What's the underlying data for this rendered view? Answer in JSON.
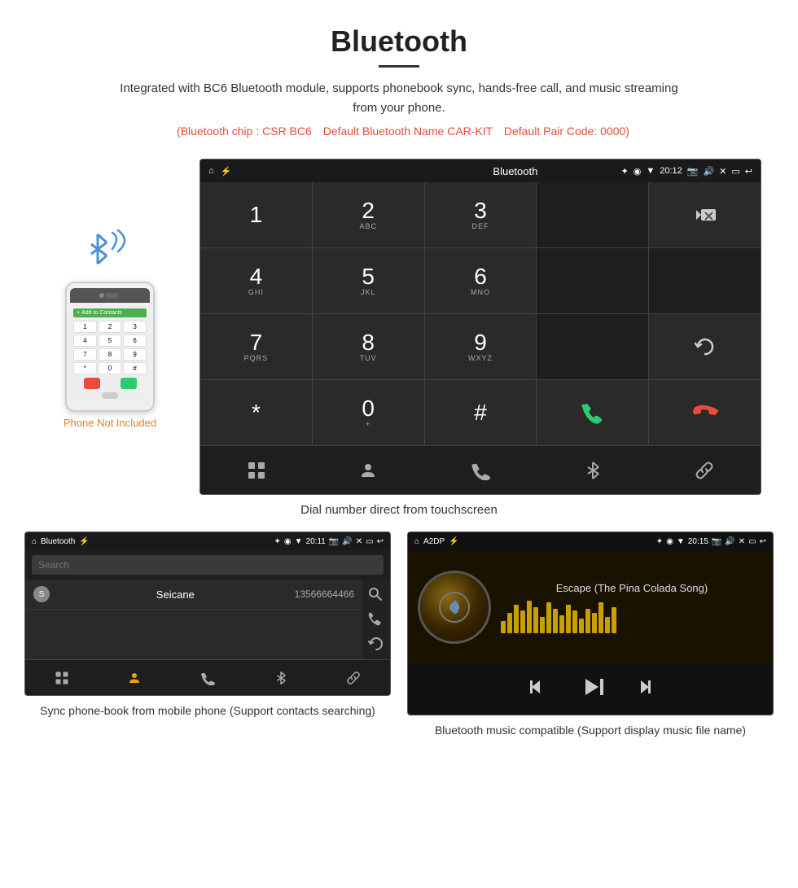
{
  "header": {
    "title": "Bluetooth",
    "description": "Integrated with BC6 Bluetooth module, supports phonebook sync, hands-free call, and music streaming from your phone.",
    "info_line": "(Bluetooth chip : CSR BC6    Default Bluetooth Name CAR-KIT    Default Pair Code: 0000)"
  },
  "main_screen": {
    "status_bar": {
      "app_name": "Bluetooth",
      "time": "20:12"
    },
    "dialpad": {
      "keys": [
        {
          "number": "1",
          "letters": ""
        },
        {
          "number": "2",
          "letters": "ABC"
        },
        {
          "number": "3",
          "letters": "DEF"
        },
        {
          "number": "",
          "letters": ""
        },
        {
          "number": "",
          "letters": "BACKSPACE"
        },
        {
          "number": "4",
          "letters": "GHI"
        },
        {
          "number": "5",
          "letters": "JKL"
        },
        {
          "number": "6",
          "letters": "MNO"
        },
        {
          "number": "",
          "letters": ""
        },
        {
          "number": "",
          "letters": ""
        },
        {
          "number": "7",
          "letters": "PQRS"
        },
        {
          "number": "8",
          "letters": "TUV"
        },
        {
          "number": "9",
          "letters": "WXYZ"
        },
        {
          "number": "",
          "letters": ""
        },
        {
          "number": "",
          "letters": "REFRESH"
        },
        {
          "number": "*",
          "letters": ""
        },
        {
          "number": "0",
          "letters": "+"
        },
        {
          "number": "#",
          "letters": ""
        },
        {
          "number": "",
          "letters": "CALL_GREEN"
        },
        {
          "number": "",
          "letters": "CALL_RED"
        }
      ]
    },
    "bottom_nav": [
      "grid",
      "person",
      "phone",
      "bluetooth",
      "link"
    ]
  },
  "main_caption": "Dial number direct from touchscreen",
  "phone_illustration": {
    "not_included_text": "Phone Not Included"
  },
  "phonebook_screen": {
    "status_bar": {
      "app_name": "Bluetooth",
      "time": "20:11"
    },
    "search_placeholder": "Search",
    "contact": {
      "letter": "S",
      "name": "Seicane",
      "number": "13566664466"
    }
  },
  "music_screen": {
    "status_bar": {
      "app_name": "A2DP",
      "time": "20:15"
    },
    "song_title": "Escape (The Pina Colada Song)",
    "eq_bars": [
      15,
      25,
      35,
      28,
      40,
      32,
      20,
      38,
      30,
      22,
      35,
      28,
      18,
      30,
      25,
      38,
      20,
      32
    ]
  },
  "bottom_captions": {
    "phonebook": "Sync phone-book from mobile phone\n(Support contacts searching)",
    "music": "Bluetooth music compatible\n(Support display music file name)"
  }
}
